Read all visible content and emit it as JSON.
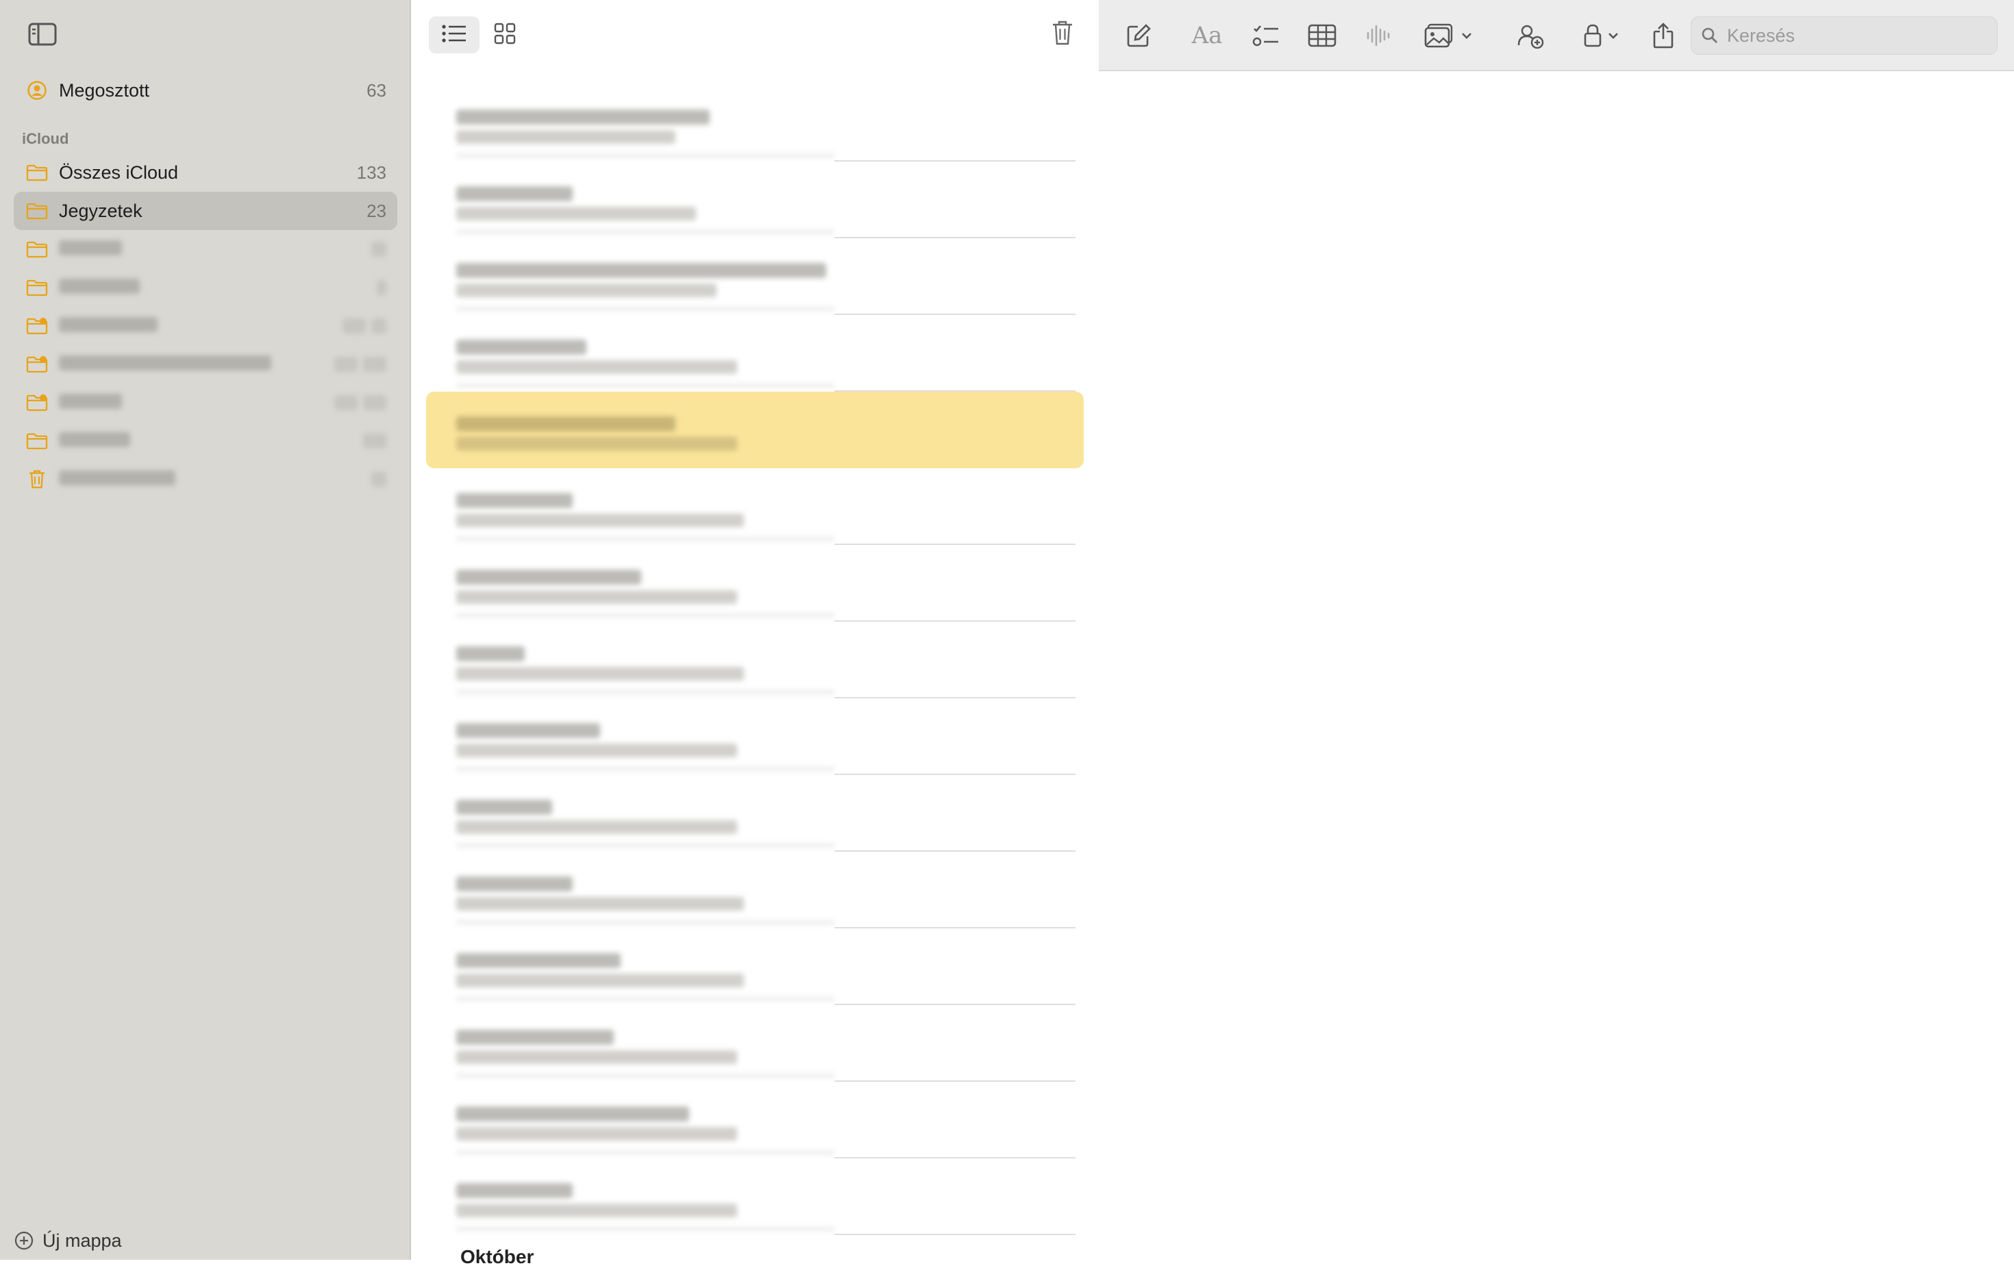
{
  "sidebar": {
    "shared": {
      "label": "Megosztott",
      "count": "63"
    },
    "section_label": "iCloud",
    "all_icloud": {
      "label": "Összes iCloud",
      "count": "133"
    },
    "notes_folder": {
      "label": "Jegyzetek",
      "count": "23"
    },
    "blurred_folders": [
      {
        "icon": "folder-icon",
        "kind": "folder"
      },
      {
        "icon": "folder-icon",
        "kind": "folder"
      },
      {
        "icon": "shared-folder-icon",
        "kind": "shared"
      },
      {
        "icon": "shared-folder-icon",
        "kind": "shared"
      },
      {
        "icon": "shared-folder-icon",
        "kind": "shared"
      },
      {
        "icon": "folder-icon",
        "kind": "folder"
      },
      {
        "icon": "trash-icon",
        "kind": "trash"
      }
    ],
    "new_folder_label": "Új mappa"
  },
  "note_list": {
    "view_modes": [
      "list-view-icon",
      "gallery-view-icon"
    ],
    "selected_index": 4,
    "note_count_visible": 15,
    "next_group_heading": "Október"
  },
  "toolbar": {
    "icons": [
      "compose-icon",
      "text-format-icon",
      "checklist-icon",
      "table-icon",
      "audio-icon",
      "media-icon",
      "collaborate-icon",
      "lock-icon",
      "share-icon"
    ],
    "format_text": "Aa",
    "search_placeholder": "Keresés"
  },
  "colors": {
    "accent": "#e8a317",
    "sidebar_bg": "#d9d8d3",
    "selected_note": "#fae49a"
  }
}
